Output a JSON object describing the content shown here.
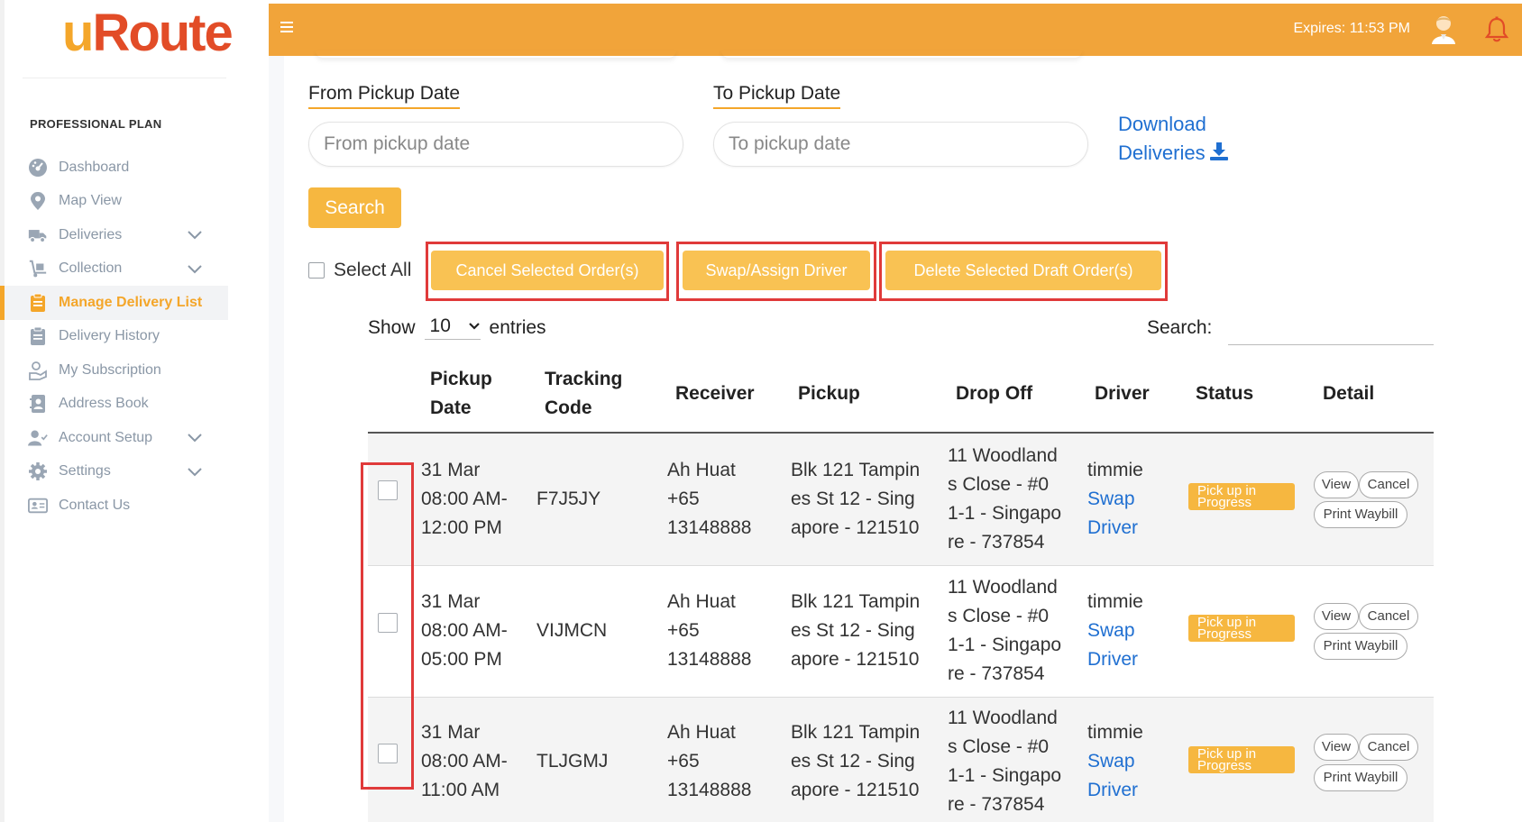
{
  "brand": {
    "logo_text_main": "u",
    "logo_text_rest": "Route"
  },
  "sidebar": {
    "plan": "PROFESSIONAL PLAN",
    "items": [
      {
        "label": "Dashboard",
        "icon": "dashboard-icon"
      },
      {
        "label": "Map View",
        "icon": "map-pin-icon"
      },
      {
        "label": "Deliveries",
        "icon": "truck-icon",
        "expandable": true
      },
      {
        "label": "Collection",
        "icon": "dolly-icon",
        "expandable": true
      },
      {
        "label": "Manage Delivery List",
        "icon": "clipboard-icon",
        "active": true
      },
      {
        "label": "Delivery History",
        "icon": "clipboard-list-icon"
      },
      {
        "label": "My Subscription",
        "icon": "hand-coin-icon"
      },
      {
        "label": "Address Book",
        "icon": "address-book-icon"
      },
      {
        "label": "Account Setup",
        "icon": "user-check-icon",
        "expandable": true
      },
      {
        "label": "Settings",
        "icon": "gear-icon",
        "expandable": true
      },
      {
        "label": "Contact Us",
        "icon": "contact-card-icon"
      }
    ]
  },
  "header": {
    "expires": "Expires: 11:53 PM"
  },
  "filters": {
    "from_label": "From Pickup Date",
    "from_placeholder": "From pickup date",
    "to_label": "To Pickup Date",
    "to_placeholder": "To pickup date",
    "download_line1": "Download",
    "download_line2": "Deliveries",
    "search_button": "Search"
  },
  "bulk": {
    "select_all": "Select All",
    "cancel_selected": "Cancel Selected Order(s)",
    "swap_assign": "Swap/Assign Driver",
    "delete_draft": "Delete Selected Draft Order(s)"
  },
  "table_controls": {
    "show": "Show",
    "page_length": "10",
    "entries": "entries",
    "search_label": "Search:"
  },
  "table": {
    "columns": [
      "Pickup Date",
      "Tracking Code",
      "Receiver",
      "Pickup",
      "Drop Off",
      "Driver",
      "Status",
      "Detail"
    ],
    "column_lines": {
      "pickup_date": [
        "Pickup",
        "Date"
      ],
      "tracking_code": [
        "Tracking",
        "Code"
      ]
    },
    "rows": [
      {
        "date": [
          "31 Mar",
          "08:00 AM-",
          "12:00 PM"
        ],
        "tracking": "F7J5JY",
        "receiver": [
          "Ah Huat",
          "+65",
          "13148888"
        ],
        "pickup": [
          "Blk 121 Tampin",
          "es St 12 - Sing",
          "apore - 121510"
        ],
        "dropoff": [
          "11 Woodland",
          "s Close - #0",
          "1-1 - Singapo",
          "re - 737854"
        ],
        "driver": "timmie",
        "swap": [
          "Swap",
          "Driver"
        ],
        "status": "Pick up in Progress",
        "actions": {
          "view": "View",
          "cancel": "Cancel",
          "print": "Print Waybill"
        }
      },
      {
        "date": [
          "31 Mar",
          "08:00 AM-",
          "05:00 PM"
        ],
        "tracking": "VIJMCN",
        "receiver": [
          "Ah Huat",
          "+65",
          "13148888"
        ],
        "pickup": [
          "Blk 121 Tampin",
          "es St 12 - Sing",
          "apore - 121510"
        ],
        "dropoff": [
          "11 Woodland",
          "s Close - #0",
          "1-1 - Singapo",
          "re - 737854"
        ],
        "driver": "timmie",
        "swap": [
          "Swap",
          "Driver"
        ],
        "status": "Pick up in Progress",
        "actions": {
          "view": "View",
          "cancel": "Cancel",
          "print": "Print Waybill"
        }
      },
      {
        "date": [
          "31 Mar",
          "08:00 AM-",
          "11:00 AM"
        ],
        "tracking": "TLJGMJ",
        "receiver": [
          "Ah Huat",
          "+65",
          "13148888"
        ],
        "pickup": [
          "Blk 121 Tampin",
          "es St 12 - Sing",
          "apore - 121510"
        ],
        "dropoff": [
          "11 Woodland",
          "s Close - #0",
          "1-1 - Singapo",
          "re - 737854"
        ],
        "driver": "timmie",
        "swap": [
          "Swap",
          "Driver"
        ],
        "status": "Pick up in Progress",
        "actions": {
          "view": "View",
          "cancel": "Cancel",
          "print": "Print Waybill"
        }
      }
    ]
  },
  "colors": {
    "accent": "#f1a43a",
    "button": "#f9c253",
    "link": "#1f6fd1",
    "highlight_border": "#e03a3a",
    "logo_red": "#e24c27"
  }
}
